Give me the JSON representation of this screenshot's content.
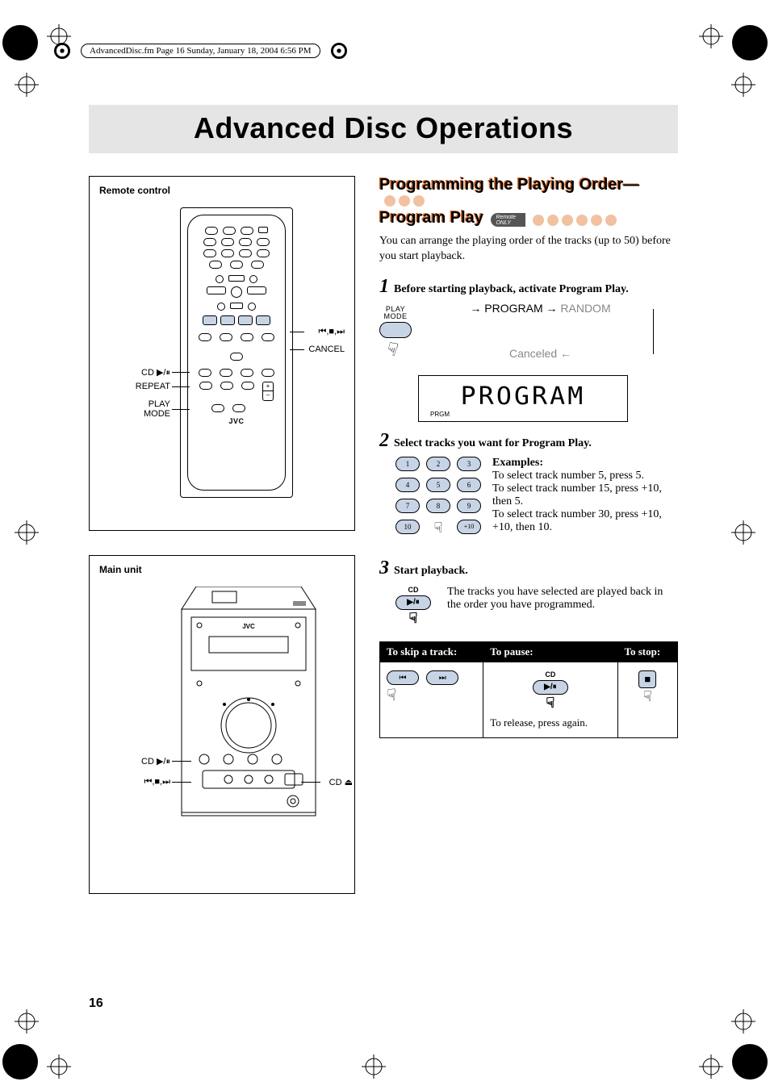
{
  "meta": {
    "header_tag": "AdvancedDisc.fm  Page 16  Sunday, January 18, 2004  6:56 PM",
    "page_number": "16"
  },
  "title": "Advanced Disc Operations",
  "panels": {
    "remote": {
      "title": "Remote control",
      "brand": "JVC",
      "labels": {
        "transport": "⏮,■,⏭",
        "cancel": "CANCEL",
        "cd": "CD ▶/⏸",
        "repeat": "REPEAT",
        "playmode_l1": "PLAY",
        "playmode_l2": "MODE"
      }
    },
    "mainunit": {
      "title": "Main unit",
      "brand": "JVC",
      "labels": {
        "cd": "CD ▶/⏸",
        "transport": "⏮,■,⏭",
        "eject": "CD ⏏"
      }
    }
  },
  "section": {
    "heading_line1": "Programming the Playing Order—",
    "heading_line2": "Program Play",
    "remote_only_l1": "Remote",
    "remote_only_l2": "ONLY",
    "intro": "You can arrange the playing order of the tracks (up to 50) before you start playback."
  },
  "steps": {
    "s1": {
      "num": "1",
      "text": "Before starting playback, activate Program Play.",
      "btn_label_l1": "PLAY",
      "btn_label_l2": "MODE",
      "state_program": "PROGRAM",
      "state_random": "RANDOM",
      "state_canceled": "Canceled",
      "display_text": "PROGRAM",
      "display_sub": "PRGM"
    },
    "s2": {
      "num": "2",
      "text": "Select tracks you want for Program Play.",
      "keys": [
        "1",
        "2",
        "3",
        "4",
        "5",
        "6",
        "7",
        "8",
        "9",
        "10",
        "",
        "+10"
      ],
      "examples_hdr": "Examples:",
      "examples_body": "To select track number 5, press 5.\nTo select track number 15, press +10, then 5.\nTo select track number 30, press +10, +10, then 10."
    },
    "s3": {
      "num": "3",
      "text": "Start playback.",
      "btn_label": "CD",
      "btn_icon": "▶/⏸",
      "desc": "The tracks you have selected are played back in the order you have programmed."
    }
  },
  "table": {
    "h_skip": "To skip a track:",
    "h_pause": "To pause:",
    "h_stop": "To stop:",
    "skip_prev": "⏮",
    "skip_next": "⏭",
    "pause_label": "CD",
    "pause_icon": "▶/⏸",
    "pause_note": "To release, press again.",
    "stop_icon": "■"
  }
}
